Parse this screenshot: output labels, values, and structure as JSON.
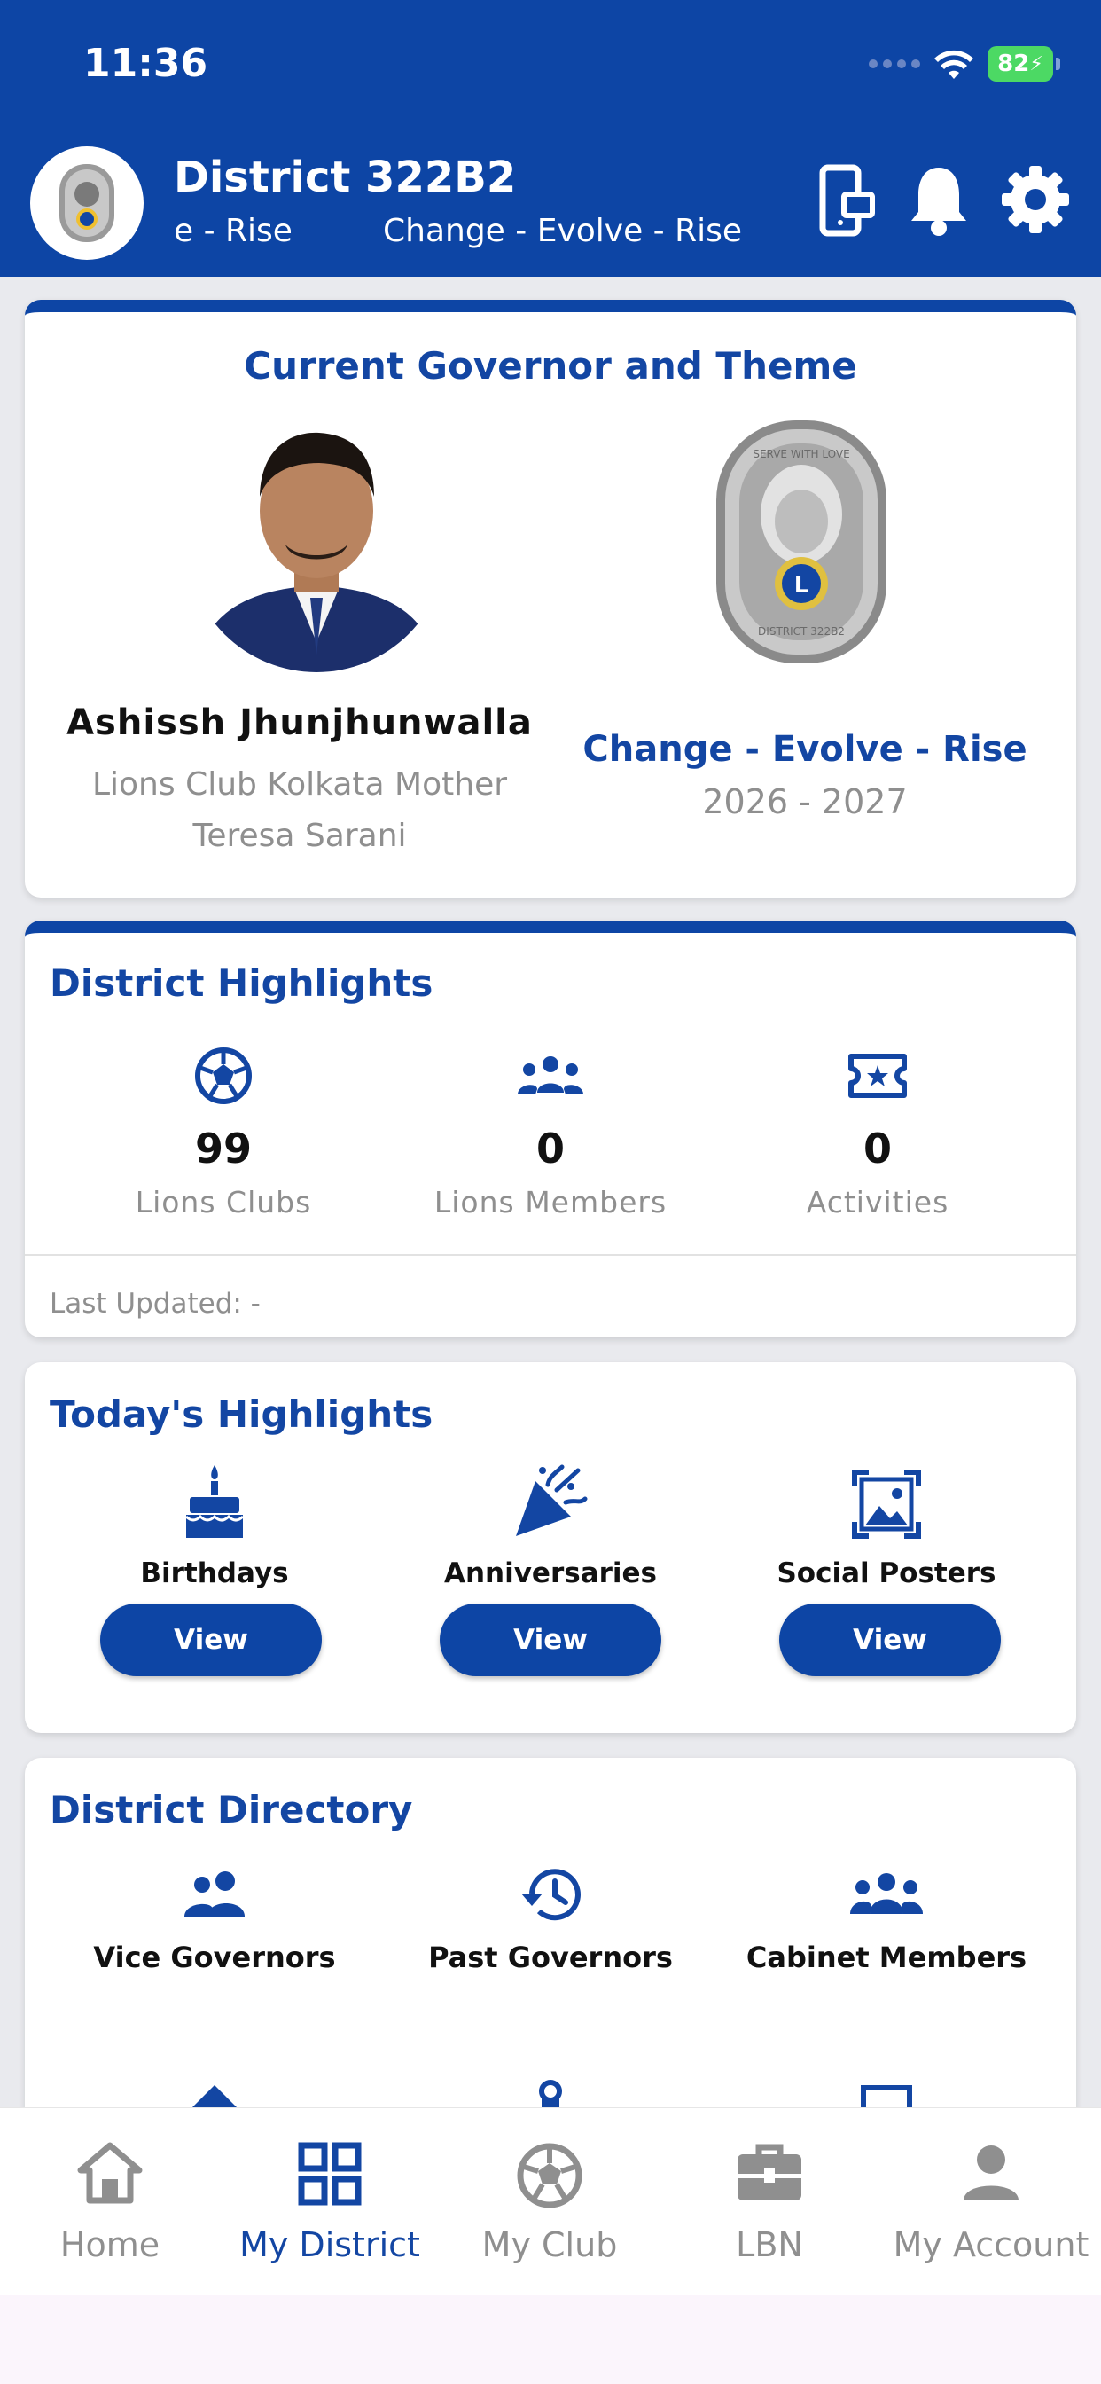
{
  "status": {
    "time": "11:36",
    "battery": "82"
  },
  "header": {
    "title": "District 322B2",
    "marquee_a": "e - Rise",
    "marquee_b": "Change - Evolve - Rise"
  },
  "governor_card": {
    "title": "Current Governor and Theme",
    "governor_name": "Ashissh Jhunjhunwalla",
    "club_line1": "Lions Club Kolkata Mother",
    "club_line2": "Teresa Sarani",
    "theme": "Change - Evolve - Rise",
    "years": "2026 - 2027",
    "medal_text_top": "SERVE WITH LOVE",
    "medal_text_bottom": "DISTRICT 322B2",
    "medal_center": "L"
  },
  "district_highlights": {
    "title": "District Highlights",
    "stats": [
      {
        "value": "99",
        "label": "Lions Clubs",
        "icon": "soccer-ball-icon"
      },
      {
        "value": "0",
        "label": "Lions Members",
        "icon": "group-icon"
      },
      {
        "value": "0",
        "label": "Activities",
        "icon": "ticket-star-icon"
      }
    ],
    "last_updated": "Last Updated: -"
  },
  "todays_highlights": {
    "title": "Today's Highlights",
    "items": [
      {
        "label": "Birthdays",
        "button": "View",
        "icon": "cake-icon"
      },
      {
        "label": "Anniversaries",
        "button": "View",
        "icon": "party-popper-icon"
      },
      {
        "label": "Social Posters",
        "button": "View",
        "icon": "image-frame-icon"
      }
    ]
  },
  "district_directory": {
    "title": "District Directory",
    "items": [
      {
        "label": "Vice Governors",
        "icon": "people-icon"
      },
      {
        "label": "Past Governors",
        "icon": "history-icon"
      },
      {
        "label": "Cabinet Members",
        "icon": "groups-icon"
      }
    ]
  },
  "bottom_nav": {
    "items": [
      {
        "label": "Home",
        "icon": "home-icon",
        "active": false
      },
      {
        "label": "My District",
        "icon": "grid-icon",
        "active": true
      },
      {
        "label": "My Club",
        "icon": "soccer-ball-icon",
        "active": false
      },
      {
        "label": "LBN",
        "icon": "briefcase-icon",
        "active": false
      },
      {
        "label": "My Account",
        "icon": "person-icon",
        "active": false
      }
    ]
  },
  "colors": {
    "primary": "#0d45a5",
    "title_blue": "#1346a3",
    "muted": "#8f8f8f",
    "background": "#e9eaee"
  }
}
